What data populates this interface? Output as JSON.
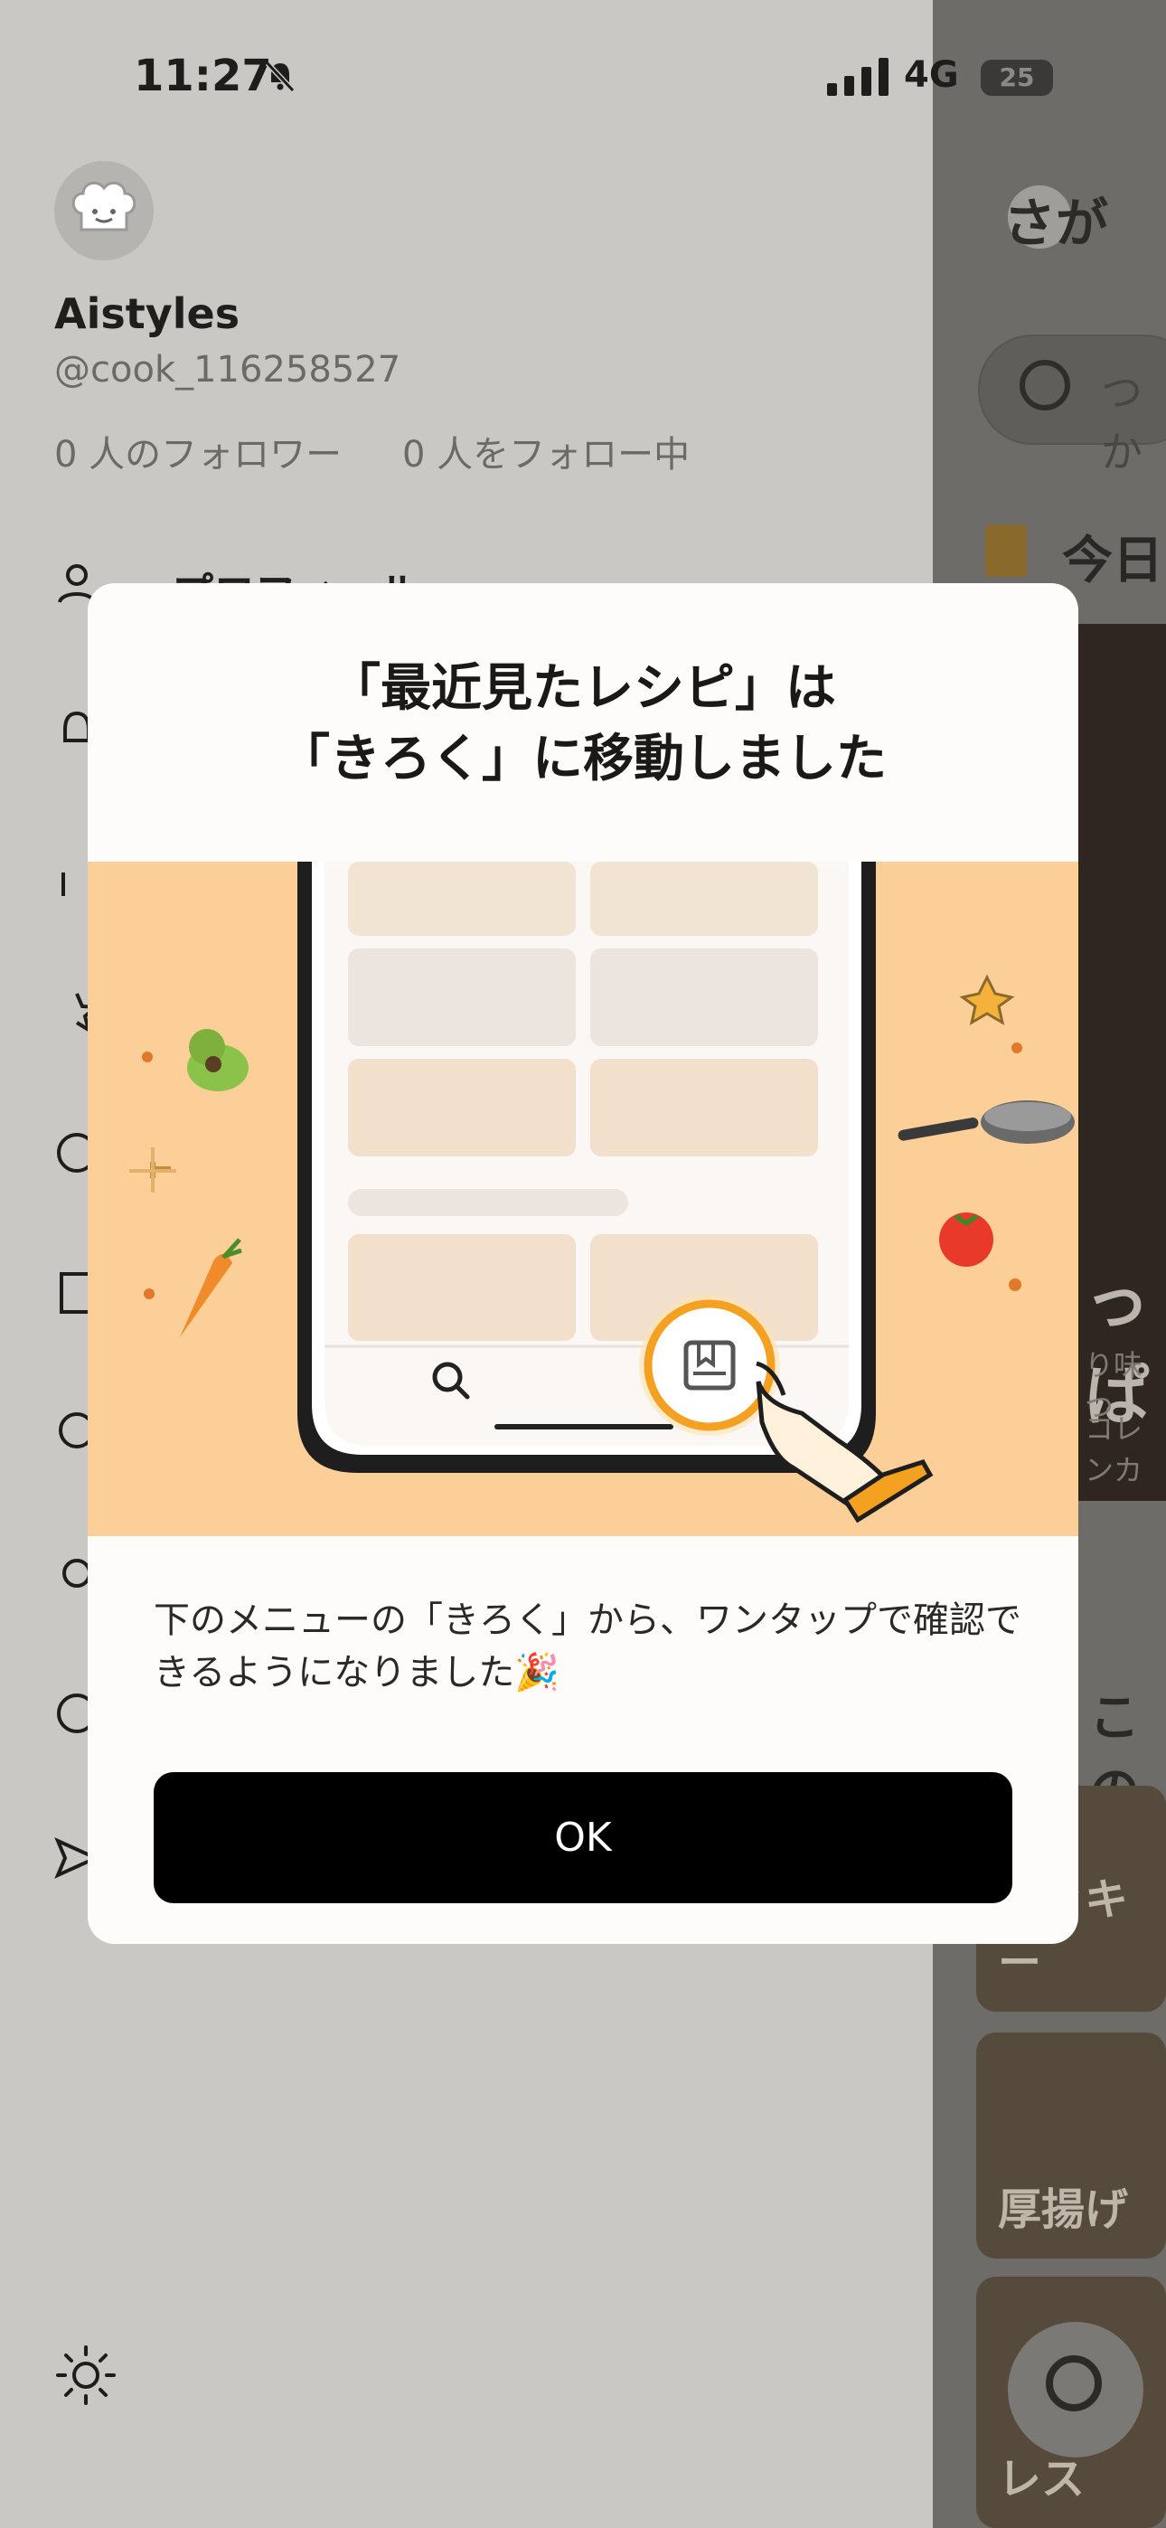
{
  "status_bar": {
    "time": "11:27",
    "network": "4G",
    "battery": "25"
  },
  "drawer": {
    "username": "Aistyles",
    "handle": "@cook_116258527",
    "followers": "0 人のフォロワー",
    "following": "0 人をフォロー中",
    "menu_first_label": "プロフィール"
  },
  "background_main": {
    "header_partial": "さが",
    "search_partial": "つか",
    "today_partial": "今日",
    "hero_title_partial": "っぱ",
    "hero_sub1_partial": "り味つ",
    "hero_sub2_partial": "コレンカ",
    "section_title_partial": "この食",
    "thumb_labels": [
      "スッキー",
      "厚揚げ",
      "レス"
    ]
  },
  "modal": {
    "title_line1": "「最近見たレシピ」は",
    "title_line2": "「きろく」に移動しました",
    "body": "下のメニューの「きろく」から、ワンタップで確認できるようになりました🎉",
    "ok_label": "OK"
  },
  "colors": {
    "illustration_bg": "#fccf98",
    "accent_orange": "#f4a020",
    "button_bg": "#000000"
  }
}
